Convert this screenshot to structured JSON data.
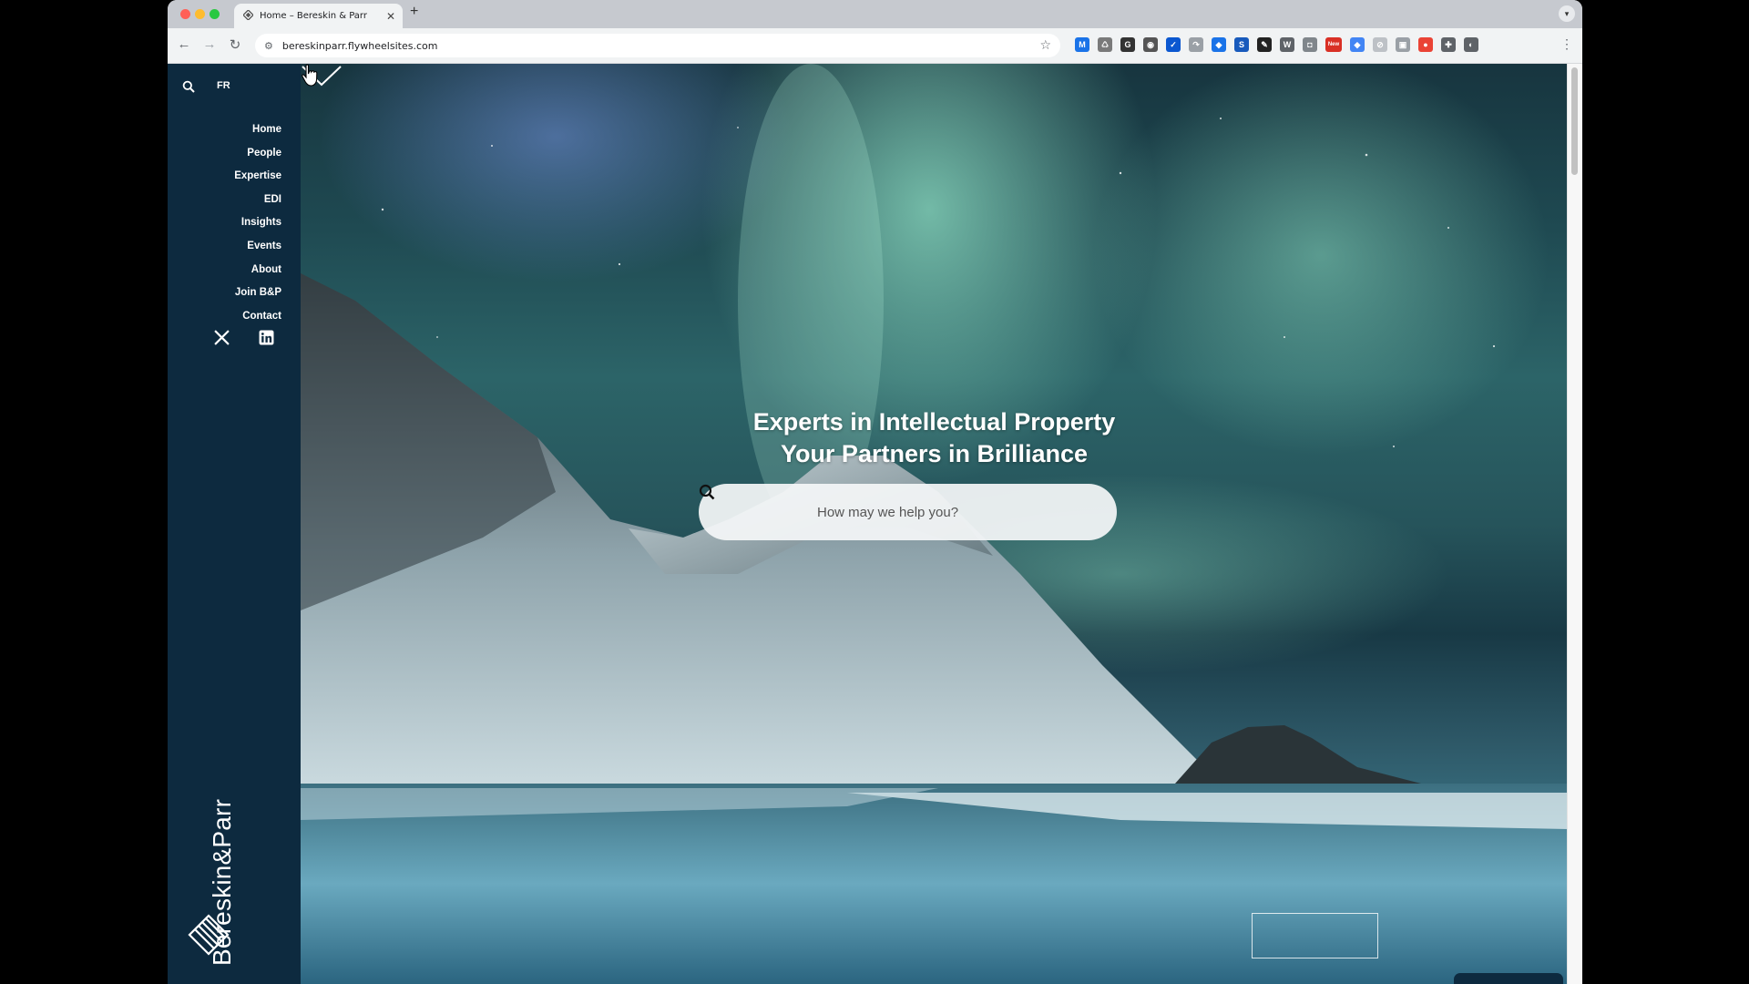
{
  "browser": {
    "tab_title": "Home – Bereskin & Parr",
    "tab_close": "✕",
    "new_tab": "+",
    "url": "bereskinparr.flywheelsites.com",
    "back": "←",
    "forward": "→",
    "reload": "↻",
    "bookmark": "☆",
    "menu": "⋮",
    "extensions": [
      {
        "icon": "m-icon",
        "label": "M",
        "color": "#1a73e8"
      },
      {
        "icon": "recycle-icon",
        "label": "♺",
        "color": "#7a7a7a"
      },
      {
        "icon": "g-icon",
        "label": "G",
        "color": "#333333"
      },
      {
        "icon": "record-icon",
        "label": "◉",
        "color": "#555555"
      },
      {
        "icon": "check-icon",
        "label": "✓",
        "color": "#0b57d0"
      },
      {
        "icon": "curve-icon",
        "label": "↷",
        "color": "#9aa0a6"
      },
      {
        "icon": "tag-icon",
        "label": "◆",
        "color": "#1a73e8"
      },
      {
        "icon": "s-icon",
        "label": "S",
        "color": "#185abc"
      },
      {
        "icon": "pen-icon",
        "label": "✎",
        "color": "#222222"
      },
      {
        "icon": "wordpress-icon",
        "label": "W",
        "color": "#5f6368"
      },
      {
        "icon": "camera-icon",
        "label": "◘",
        "color": "#80868b"
      },
      {
        "icon": "new-badge-icon",
        "label": "New",
        "color": "#d93025"
      },
      {
        "icon": "tag2-icon",
        "label": "◆",
        "color": "#4285f4"
      },
      {
        "icon": "slash-icon",
        "label": "⊘",
        "color": "#bdc1c6"
      },
      {
        "icon": "box-icon",
        "label": "▣",
        "color": "#9aa0a6"
      },
      {
        "icon": "red-icon",
        "label": "●",
        "color": "#ea4335"
      },
      {
        "icon": "puzzle-icon",
        "label": "✚",
        "color": "#5f6368"
      },
      {
        "icon": "profile-icon",
        "label": "◐",
        "color": "#5f6368"
      }
    ]
  },
  "sidebar": {
    "lang": "FR",
    "nav": [
      "Home",
      "People",
      "Expertise",
      "EDI",
      "Insights",
      "Events",
      "About",
      "Join B&P",
      "Contact"
    ],
    "brand": "Bereskin&Parr"
  },
  "hero": {
    "headline_1": "Experts in Intellectual Property",
    "headline_2": "Your Partners in Brilliance",
    "search_placeholder": "How may we help you?"
  },
  "colors": {
    "sidebar": "#0d2a3f",
    "text": "#ffffff"
  }
}
